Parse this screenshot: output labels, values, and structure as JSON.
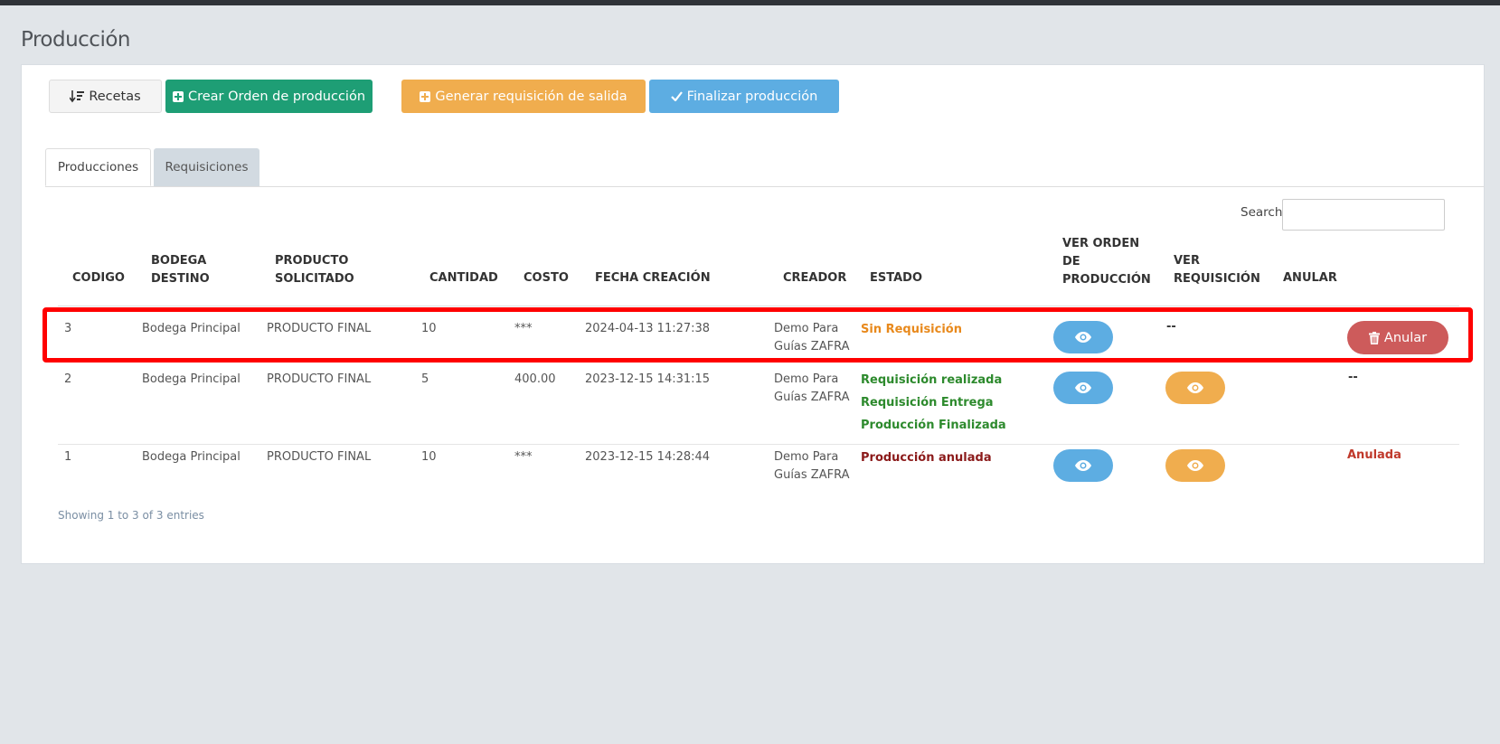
{
  "page": {
    "title": "Producción"
  },
  "toolbar": {
    "recetas": "Recetas",
    "crear_orden": "Crear Orden de producción",
    "generar_requisicion": "Generar requisición de salida",
    "finalizar": "Finalizar producción"
  },
  "tabs": [
    {
      "label": "Producciones",
      "active": true
    },
    {
      "label": "Requisiciones",
      "active": false
    }
  ],
  "search": {
    "label": "Search:",
    "value": ""
  },
  "table": {
    "headers": {
      "codigo": "CODIGO",
      "bodega_1": "BODEGA",
      "bodega_2": "DESTINO",
      "producto_1": "PRODUCTO",
      "producto_2": "SOLICITADO",
      "cantidad": "CANTIDAD",
      "costo": "COSTO",
      "fecha": "FECHA CREACIÓN",
      "creador": "CREADOR",
      "estado": "ESTADO",
      "ver_orden_1": "VER ORDEN",
      "ver_orden_2": "DE",
      "ver_orden_3": "PRODUCCIÓN",
      "ver_req_1": "VER",
      "ver_req_2": "REQUISICIÓN",
      "anular": "ANULAR"
    },
    "rows": [
      {
        "codigo": "3",
        "bodega": "Bodega Principal",
        "producto": "PRODUCTO FINAL",
        "cantidad": "10",
        "costo": "***",
        "fecha": "2024-04-13 11:27:38",
        "creador_1": "Demo Para",
        "creador_2": "Guías ZAFRA",
        "estado": [
          "Sin Requisición"
        ],
        "ver_requisicion": "--",
        "anular": "Anular"
      },
      {
        "codigo": "2",
        "bodega": "Bodega Principal",
        "producto": "PRODUCTO FINAL",
        "cantidad": "5",
        "costo": "400.00",
        "fecha": "2023-12-15 14:31:15",
        "creador_1": "Demo Para",
        "creador_2": "Guías ZAFRA",
        "estado": [
          "Requisición realizada",
          "Requisición Entrega",
          "Producción Finalizada"
        ],
        "anular": "--"
      },
      {
        "codigo": "1",
        "bodega": "Bodega Principal",
        "producto": "PRODUCTO FINAL",
        "cantidad": "10",
        "costo": "***",
        "fecha": "2023-12-15 14:28:44",
        "creador_1": "Demo Para",
        "creador_2": "Guías ZAFRA",
        "estado": [
          "Producción anulada"
        ],
        "anular": "Anulada"
      }
    ]
  },
  "footer": {
    "info": "Showing 1 to 3 of 3 entries"
  },
  "colors": {
    "primary_green": "#1e9e75",
    "warning_orange": "#f0ad4e",
    "info_blue": "#5dade2",
    "danger_red": "#cd5b5b",
    "highlight": "#ff0000"
  }
}
